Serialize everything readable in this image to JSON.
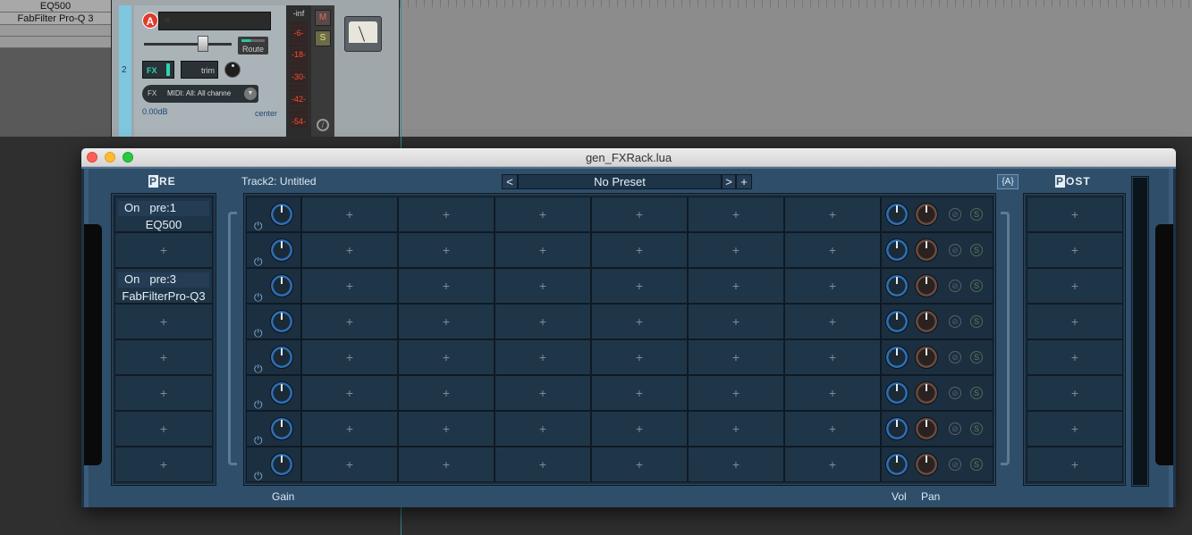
{
  "background": {
    "fx_list": [
      "EQ500",
      "FabFilter Pro-Q 3"
    ],
    "track": {
      "number": "2",
      "arm_label": "A",
      "route_label": "Route",
      "fx_label": "FX",
      "trim_label": "trim",
      "midi_fx_label": "FX",
      "midi_input": "MIDI: All: All channe",
      "volume": "0.00dB",
      "pan": "center"
    },
    "meter": {
      "labels": [
        "-inf",
        "-6-",
        "-18-",
        "-30-",
        "-42-",
        "-54-"
      ]
    },
    "mute_label": "M",
    "solo_label": "S"
  },
  "window": {
    "title": "gen_FXRack.lua",
    "pre_title": "PRE",
    "post_title": "POST",
    "track_label": "Track2: Untitled",
    "preset": {
      "prev": "<",
      "name": "No Preset",
      "next": ">",
      "add": "+"
    },
    "a_button": "{A}",
    "footer": {
      "gain": "Gain",
      "vol": "Vol",
      "pan": "Pan"
    },
    "pre_slots": [
      {
        "state": "On",
        "id": "pre:1",
        "name": "EQ500"
      },
      {
        "empty": "+"
      },
      {
        "state": "On",
        "id": "pre:3",
        "name": "FabFilterPro-Q3"
      },
      {
        "empty": "+"
      },
      {
        "empty": "+"
      },
      {
        "empty": "+"
      },
      {
        "empty": "+"
      },
      {
        "empty": "+"
      }
    ],
    "grid_rows": 8,
    "grid_columns": 6,
    "empty_symbol": "+",
    "power_icon": "power-icon",
    "mute_icon": "⊘",
    "solo_icon": "S",
    "post_slots": [
      "+",
      "+",
      "+",
      "+",
      "+",
      "+",
      "+",
      "+"
    ]
  }
}
